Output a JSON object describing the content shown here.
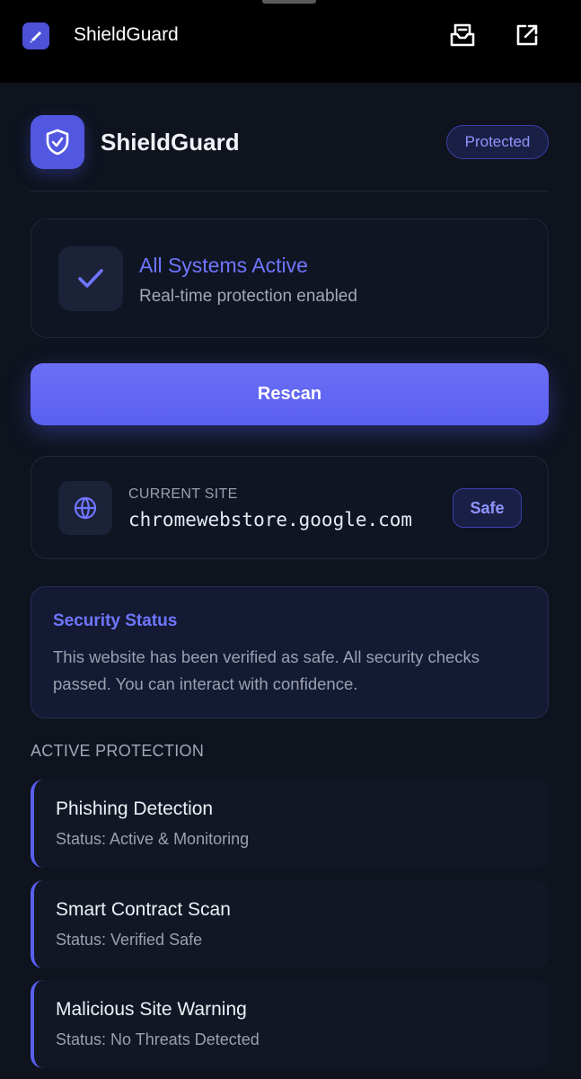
{
  "topbar": {
    "title": "ShieldGuard",
    "icons": {
      "extension": "shield-extension-icon",
      "save": "save-page-icon",
      "open": "open-external-icon"
    }
  },
  "header": {
    "title": "ShieldGuard",
    "badge": "Protected",
    "logo_icon": "shield-check-icon"
  },
  "status": {
    "title": "All Systems Active",
    "subtitle": "Real-time protection enabled",
    "icon": "checkmark-icon"
  },
  "actions": {
    "rescan_label": "Rescan"
  },
  "site": {
    "label": "CURRENT SITE",
    "domain": "chromewebstore.google.com",
    "badge": "Safe",
    "icon": "globe-icon"
  },
  "security": {
    "title": "Security Status",
    "text": "This website has been verified as safe. All security checks passed. You can interact with confidence."
  },
  "protection": {
    "section_title": "ACTIVE PROTECTION",
    "items": [
      {
        "title": "Phishing Detection",
        "status": "Status: Active & Monitoring"
      },
      {
        "title": "Smart Contract Scan",
        "status": "Status: Verified Safe"
      },
      {
        "title": "Malicious Site Warning",
        "status": "Status: No Threats Detected"
      }
    ]
  },
  "colors": {
    "accent": "#5a5ff0",
    "accent_text": "#6f76ff",
    "background": "#0e131e",
    "card": "#0f1522"
  }
}
